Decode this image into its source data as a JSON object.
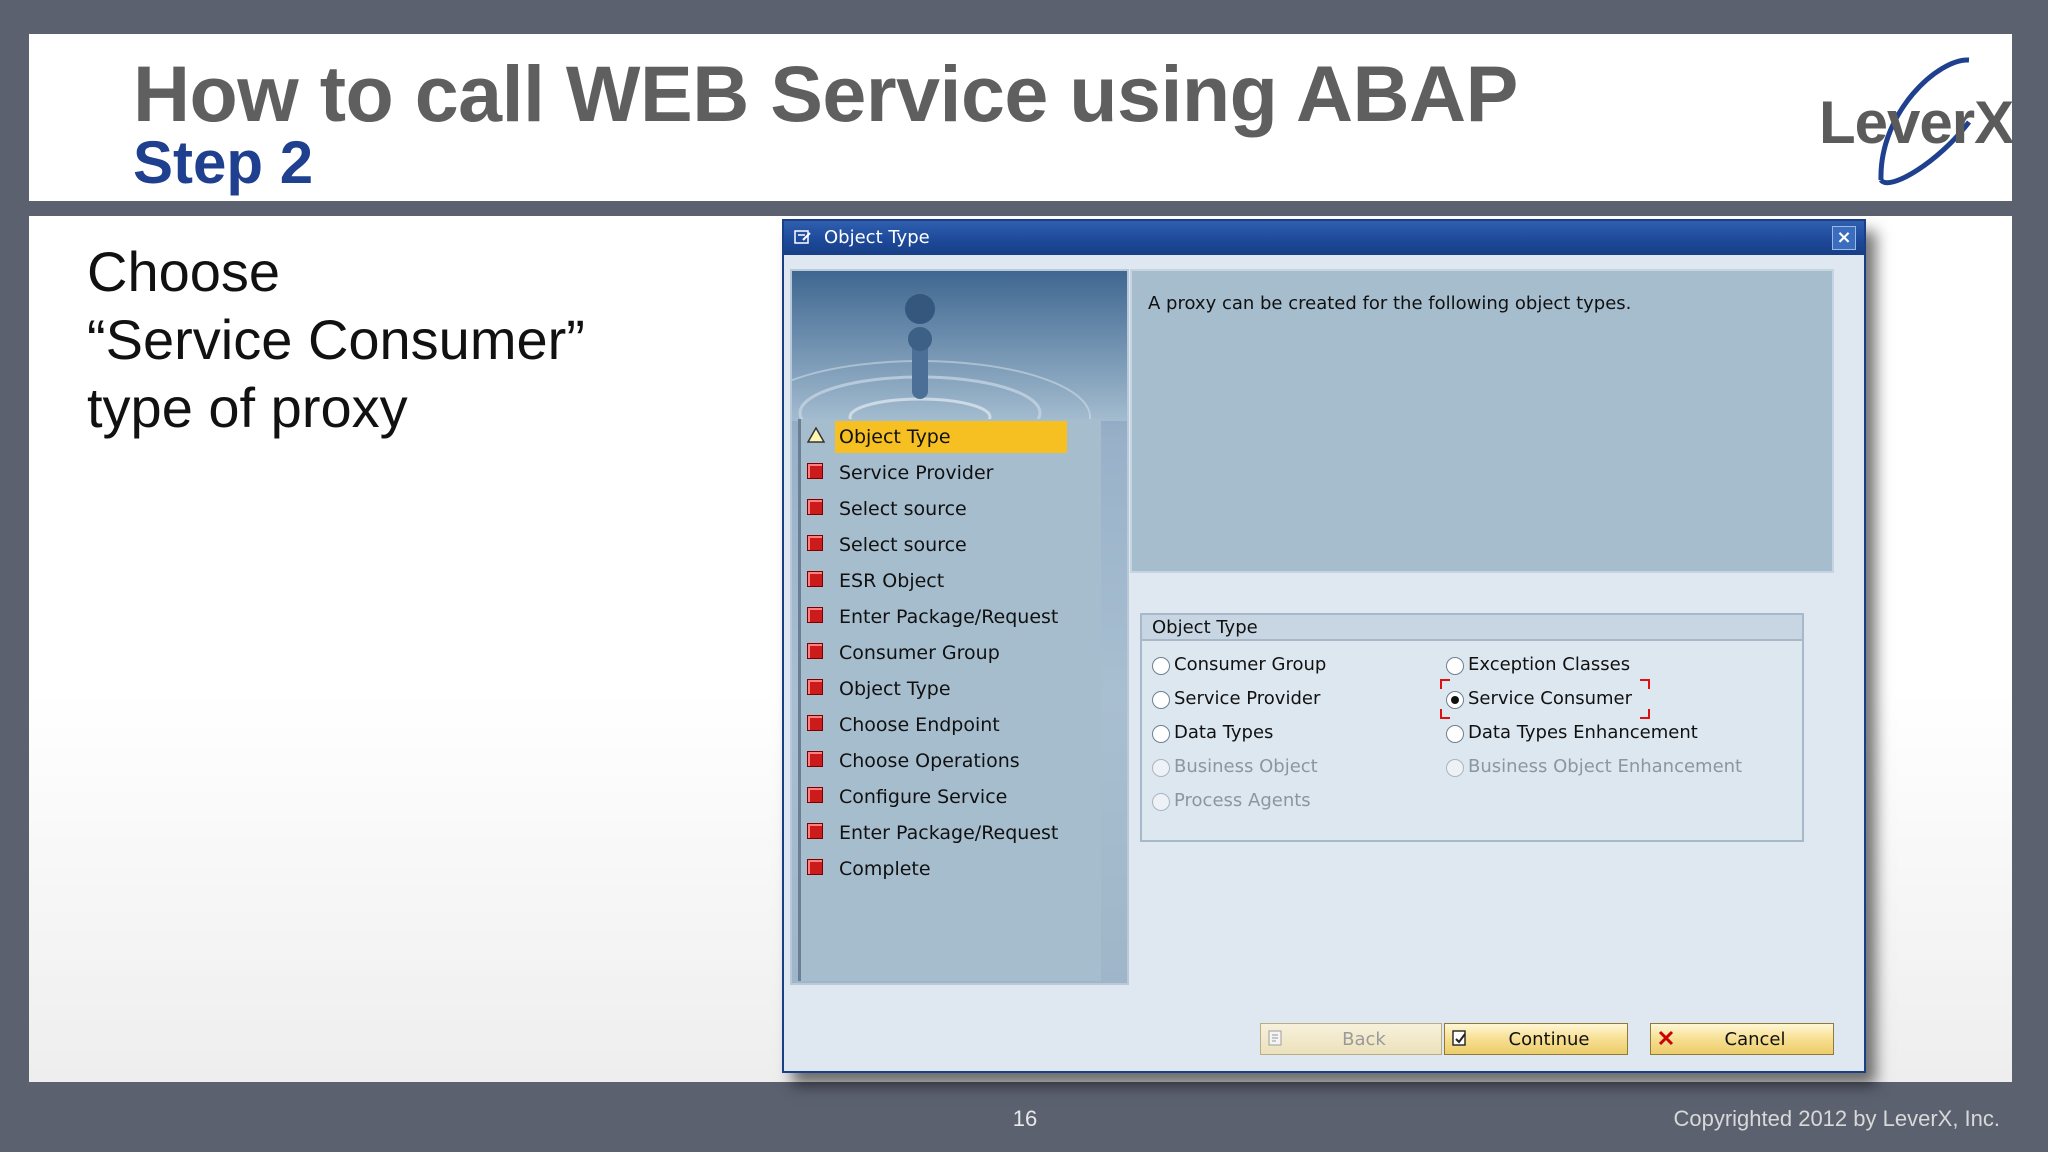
{
  "slide": {
    "title": "How to call WEB Service using ABAP",
    "subtitle": "Step 2",
    "logo": "LeverX",
    "instruction": "Choose\n“Service Consumer”\ntype of proxy",
    "slide_number": "16",
    "copyright": "Copyrighted 2012 by LeverX, Inc."
  },
  "dialog": {
    "title": "Object Type",
    "close_icon": "close-icon",
    "info_text": "A proxy can be created for the following object types.",
    "steps": [
      {
        "label": "Object Type",
        "status": "current"
      },
      {
        "label": "Service Provider",
        "status": "pending"
      },
      {
        "label": "Select source",
        "status": "pending"
      },
      {
        "label": "Select source",
        "status": "pending"
      },
      {
        "label": "ESR Object",
        "status": "pending"
      },
      {
        "label": "Enter Package/Request",
        "status": "pending"
      },
      {
        "label": "Consumer Group",
        "status": "pending"
      },
      {
        "label": "Object Type",
        "status": "pending"
      },
      {
        "label": "Choose Endpoint",
        "status": "pending"
      },
      {
        "label": "Choose Operations",
        "status": "pending"
      },
      {
        "label": "Configure Service",
        "status": "pending"
      },
      {
        "label": "Enter Package/Request",
        "status": "pending"
      },
      {
        "label": "Complete",
        "status": "pending"
      }
    ],
    "group": {
      "title": "Object Type",
      "options": [
        {
          "label": "Consumer Group",
          "checked": false,
          "enabled": true
        },
        {
          "label": "Service Provider",
          "checked": false,
          "enabled": true
        },
        {
          "label": "Data Types",
          "checked": false,
          "enabled": true
        },
        {
          "label": "Business Object",
          "checked": false,
          "enabled": false
        },
        {
          "label": "Process Agents",
          "checked": false,
          "enabled": false
        },
        {
          "label": "Exception Classes",
          "checked": false,
          "enabled": true
        },
        {
          "label": "Service Consumer",
          "checked": true,
          "enabled": true
        },
        {
          "label": "Data Types Enhancement",
          "checked": false,
          "enabled": true
        },
        {
          "label": "Business Object Enhancement",
          "checked": false,
          "enabled": false
        }
      ]
    },
    "buttons": {
      "back": "Back",
      "continue": "Continue",
      "cancel": "Cancel"
    },
    "colors": {
      "titlebar": "#1d4898",
      "active_step": "#f6bf22",
      "pending_step_icon": "#cc1b1b"
    }
  }
}
